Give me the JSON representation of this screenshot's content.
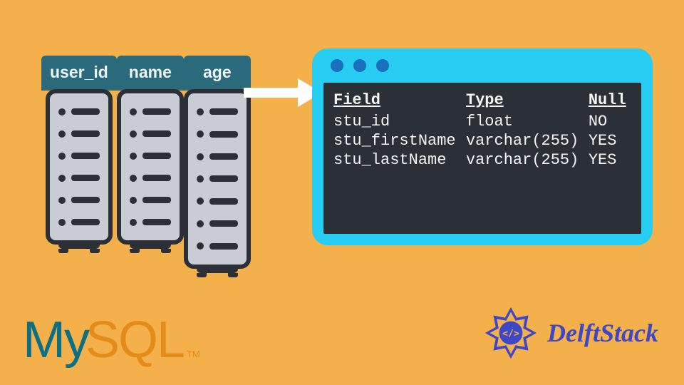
{
  "columns": [
    {
      "label": "user_id",
      "rows": 6
    },
    {
      "label": "name",
      "rows": 6
    },
    {
      "label": "age",
      "rows": 7
    }
  ],
  "terminal": {
    "headers": {
      "field": "Field",
      "type": "Type",
      "null": "Null"
    },
    "rows": [
      {
        "field": "stu_id",
        "type": "float",
        "null": "NO"
      },
      {
        "field": "stu_firstName",
        "type": "varchar(255)",
        "null": "YES"
      },
      {
        "field": "stu_lastName",
        "type": "varchar(255)",
        "null": "YES"
      }
    ]
  },
  "logos": {
    "mysql_my": "My",
    "mysql_sql": "SQL",
    "mysql_tm": "TM",
    "delft": "DelftStack"
  }
}
